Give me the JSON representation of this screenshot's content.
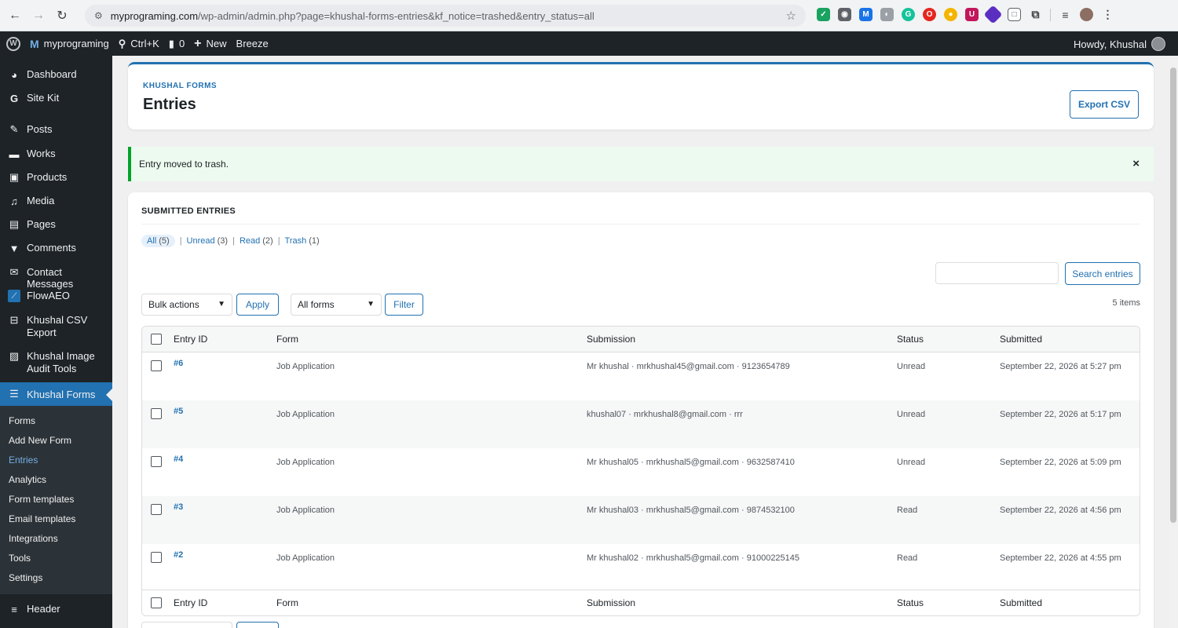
{
  "browser": {
    "url_host": "myprograming.com",
    "url_path": "/wp-admin/admin.php?page=khushal-forms-entries&kf_notice=trashed&entry_status=all"
  },
  "adminbar": {
    "site_name": "myprograming",
    "search_shortcut": "Ctrl+K",
    "comments_count": "0",
    "new_label": "New",
    "breeze_label": "Breeze",
    "howdy": "Howdy, Khushal"
  },
  "sidebar": {
    "items": [
      {
        "label": "Dashboard",
        "icon": "dashboard-icon"
      },
      {
        "label": "Site Kit",
        "icon": "google-g-icon"
      },
      {
        "label": "Posts",
        "icon": "pin-icon"
      },
      {
        "label": "Works",
        "icon": "folder-icon"
      },
      {
        "label": "Products",
        "icon": "bag-icon"
      },
      {
        "label": "Media",
        "icon": "media-icon"
      },
      {
        "label": "Pages",
        "icon": "page-icon"
      },
      {
        "label": "Comments",
        "icon": "comment-icon"
      },
      {
        "label": "Contact Messages",
        "icon": "mail-icon"
      },
      {
        "label": "FlowAEO",
        "icon": "flow-icon"
      },
      {
        "label": "Khushal CSV Export",
        "icon": "export-icon"
      },
      {
        "label": "Khushal Image Audit Tools",
        "icon": "image-icon"
      },
      {
        "label": "Khushal Forms",
        "icon": "form-icon"
      }
    ],
    "submenu": [
      "Forms",
      "Add New Form",
      "Entries",
      "Analytics",
      "Form templates",
      "Email templates",
      "Integrations",
      "Tools",
      "Settings"
    ],
    "bottom_item": "Header"
  },
  "header": {
    "kicker": "KHUSHAL FORMS",
    "title": "Entries",
    "export_label": "Export CSV"
  },
  "notice": {
    "text": "Entry moved to trash.",
    "close": "×"
  },
  "entries": {
    "section_title": "SUBMITTED ENTRIES",
    "filters": [
      {
        "label": "All",
        "count": "(5)"
      },
      {
        "label": "Unread",
        "count": "(3)"
      },
      {
        "label": "Read",
        "count": "(2)"
      },
      {
        "label": "Trash",
        "count": "(1)"
      }
    ],
    "search_placeholder": "",
    "search_button": "Search entries",
    "bulk_label": "Bulk actions",
    "apply_label": "Apply",
    "forms_label": "All forms",
    "filter_label": "Filter",
    "items_count": "5 items",
    "columns": [
      "Entry ID",
      "Form",
      "Submission",
      "Status",
      "Submitted"
    ],
    "rows": [
      {
        "id": "#6",
        "form": "Job Application",
        "submission": "Mr khushal · mrkhushal45@gmail.com · 9123654789",
        "status": "Unread",
        "submitted": "September 22, 2026 at 5:27 pm"
      },
      {
        "id": "#5",
        "form": "Job Application",
        "submission": "khushal07 · mrkhushal8@gmail.com · rrr",
        "status": "Unread",
        "submitted": "September 22, 2026 at 5:17 pm"
      },
      {
        "id": "#4",
        "form": "Job Application",
        "submission": "Mr khushal05 · mrkhushal5@gmail.com · 9632587410",
        "status": "Unread",
        "submitted": "September 22, 2026 at 5:09 pm"
      },
      {
        "id": "#3",
        "form": "Job Application",
        "submission": "Mr khushal03 · mrkhushal5@gmail.com · 9874532100",
        "status": "Read",
        "submitted": "September 22, 2026 at 4:56 pm"
      },
      {
        "id": "#2",
        "form": "Job Application",
        "submission": "Mr khushal02 · mrkhushal5@gmail.com · 91000225145",
        "status": "Read",
        "submitted": "September 22, 2026 at 4:55 pm"
      }
    ]
  },
  "colors": {
    "accent": "#2271b1",
    "admin_dark": "#1d2327",
    "notice_green": "#00a32a"
  }
}
